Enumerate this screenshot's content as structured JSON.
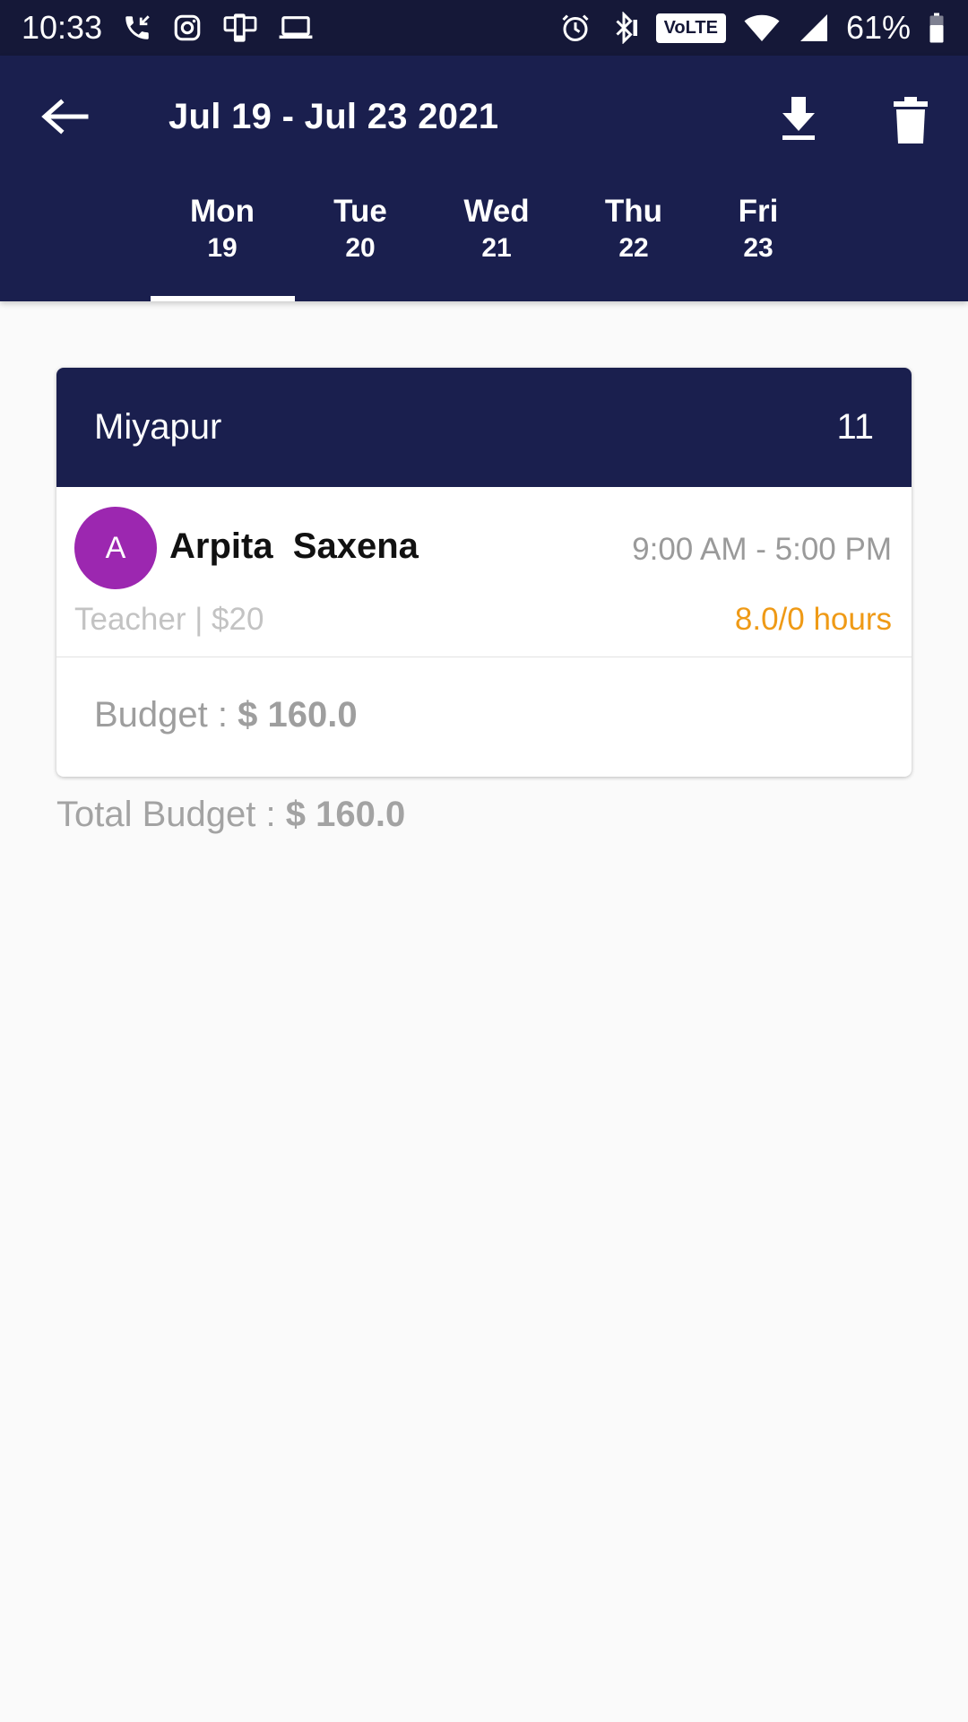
{
  "status_bar": {
    "time": "10:33",
    "battery": "61%",
    "network_badge": "VoLTE",
    "left_icons": [
      "wifi-calling-icon",
      "instagram-icon",
      "device-icon",
      "laptop-icon"
    ],
    "right_icons": [
      "alarm-icon",
      "bluetooth-icon",
      "volte-icon",
      "wifi-icon",
      "cell-signal-icon",
      "battery-icon"
    ]
  },
  "appbar": {
    "title": "Jul 19 - Jul 23 2021",
    "back_icon": "arrow-left-icon",
    "download_icon": "download-icon",
    "delete_icon": "trash-icon",
    "background": "#1a1f4e"
  },
  "tabs": [
    {
      "day": "Mon",
      "date": "19",
      "selected": true
    },
    {
      "day": "Tue",
      "date": "20",
      "selected": false
    },
    {
      "day": "Wed",
      "date": "21",
      "selected": false
    },
    {
      "day": "Thu",
      "date": "22",
      "selected": false
    },
    {
      "day": "Fri",
      "date": "23",
      "selected": false
    }
  ],
  "location_card": {
    "location": "Miyapur",
    "count": "11",
    "employee": {
      "initial": "A",
      "name": "Arpita  Saxena",
      "shift": "9:00 AM - 5:00 PM",
      "role_rate": "Teacher | $20",
      "hours": "8.0/0 hours",
      "avatar_color": "#9c27b0",
      "hours_color": "#ef9a16"
    },
    "budget_label": "Budget : ",
    "budget_value": "$ 160.0"
  },
  "total_budget": {
    "label": "Total Budget : ",
    "value": "$ 160.0"
  }
}
